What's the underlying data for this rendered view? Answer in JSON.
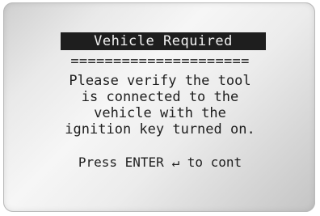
{
  "screen": {
    "title": "Vehicle Required",
    "divider": "=====================",
    "message_lines": [
      "Please verify the tool",
      "is connected to the",
      "vehicle with the",
      "ignition key turned on."
    ],
    "prompt": "Press ENTER ↵ to cont"
  },
  "colors": {
    "text": "#1e1e1e",
    "title_background": "#1e1e1e",
    "title_text": "#f2f2f2",
    "screen_background": "#ececec"
  }
}
